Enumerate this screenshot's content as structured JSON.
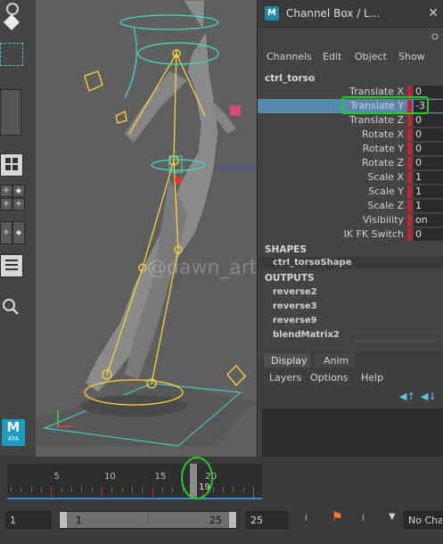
{
  "window": {
    "title": "Channel Box / L...",
    "close_glyph": "✕",
    "logo_label": "M"
  },
  "menu": [
    "Channels",
    "Edit",
    "Object",
    "Show"
  ],
  "object_name": "ctrl_torso",
  "channels": [
    {
      "label": "Translate X",
      "value": "0"
    },
    {
      "label": "Translate Y",
      "value": "-3"
    },
    {
      "label": "Translate Z",
      "value": "0"
    },
    {
      "label": "Rotate X",
      "value": "0"
    },
    {
      "label": "Rotate Y",
      "value": "0"
    },
    {
      "label": "Rotate Z",
      "value": "0"
    },
    {
      "label": "Scale X",
      "value": "1"
    },
    {
      "label": "Scale Y",
      "value": "1"
    },
    {
      "label": "Scale Z",
      "value": "1"
    },
    {
      "label": "Visibility",
      "value": "on"
    },
    {
      "label": "IK FK Switch",
      "value": "0"
    }
  ],
  "shapes": {
    "heading": "SHAPES",
    "items": [
      "ctrl_torsoShape"
    ]
  },
  "outputs": {
    "heading": "OUTPUTS",
    "items": [
      "reverse2",
      "reverse3",
      "reverse9",
      "blendMatrix2"
    ]
  },
  "layer_tabs": [
    "Display",
    "Anim"
  ],
  "layer_menu": [
    "Layers",
    "Options",
    "Help"
  ],
  "timeline": {
    "ticks": [
      "5",
      "10",
      "15",
      "20"
    ],
    "current_frame": "19"
  },
  "range": {
    "start": "1",
    "range_start": "1",
    "range_end": "25",
    "end": "25",
    "character": "No Cha"
  },
  "watermark": "@dawn_art",
  "toolbar_logo": {
    "letter": "M",
    "caption": "AYA"
  },
  "colors": {
    "accent_green": "#22cc22",
    "selection_blue": "#5689ad",
    "keyed_red": "#c0262d",
    "rig_yellow": "#ffd23a",
    "rig_cyan": "#3fe0c0"
  }
}
